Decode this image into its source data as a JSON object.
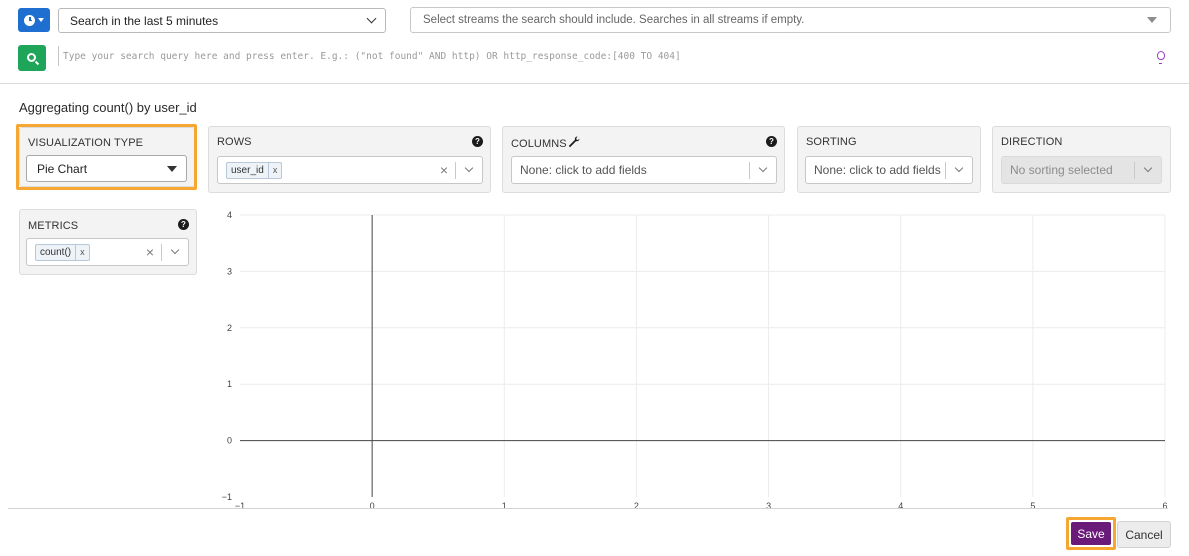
{
  "search": {
    "time_icon": "clock-icon",
    "time_range": "Search in the last 5 minutes",
    "streams_placeholder": "Select streams the search should include. Searches in all streams if empty.",
    "query_placeholder": "Type your search query here and press enter. E.g.: (\"not found\" AND http) OR http_response_code:[400 TO 404]",
    "search_icon": "search-icon",
    "hint_icon": "lightbulb-icon"
  },
  "aggregation": {
    "title": "Aggregating count() by user_id",
    "visualization": {
      "label": "VISUALIZATION TYPE",
      "value": "Pie Chart"
    },
    "rows": {
      "label": "ROWS",
      "tags": [
        "user_id"
      ],
      "tag_remove": "x",
      "clear": "×"
    },
    "columns": {
      "label": "COLUMNS",
      "placeholder": "None: click to add fields",
      "icon": "wrench-icon"
    },
    "sorting": {
      "label": "SORTING",
      "placeholder": "None: click to add fields"
    },
    "direction": {
      "label": "DIRECTION",
      "placeholder": "No sorting selected"
    },
    "metrics": {
      "label": "METRICS",
      "tags": [
        "count()"
      ],
      "tag_remove": "x",
      "clear": "×"
    },
    "help_glyph": "?"
  },
  "chart_data": {
    "type": "scatter",
    "title": "",
    "xlabel": "",
    "ylabel": "",
    "x_ticks": [
      -1,
      0,
      1,
      2,
      3,
      4,
      5,
      6
    ],
    "y_ticks": [
      -1,
      0,
      1,
      2,
      3,
      4
    ],
    "xlim": [
      -1,
      6
    ],
    "ylim": [
      -1,
      4
    ],
    "grid": true,
    "series": []
  },
  "footer": {
    "save": "Save",
    "cancel": "Cancel"
  },
  "colors": {
    "accent_blue": "#1e6fcf",
    "search_green": "#1fa55a",
    "save_purple": "#6a1b7a",
    "highlight_orange": "#f7a631"
  }
}
